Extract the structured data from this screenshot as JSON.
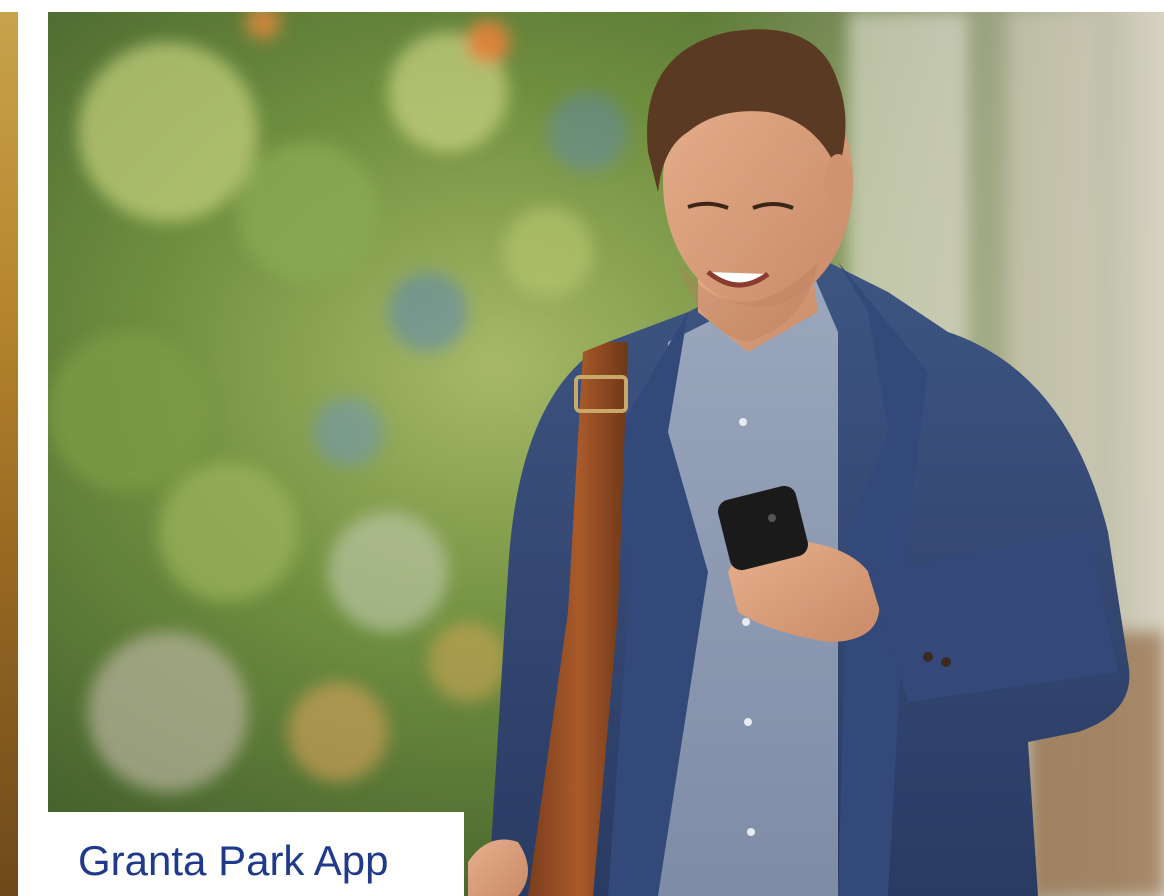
{
  "card": {
    "title": "Granta Park App",
    "image_icon": "photo-person-with-phone",
    "accent_color": "#1f3a8a"
  }
}
